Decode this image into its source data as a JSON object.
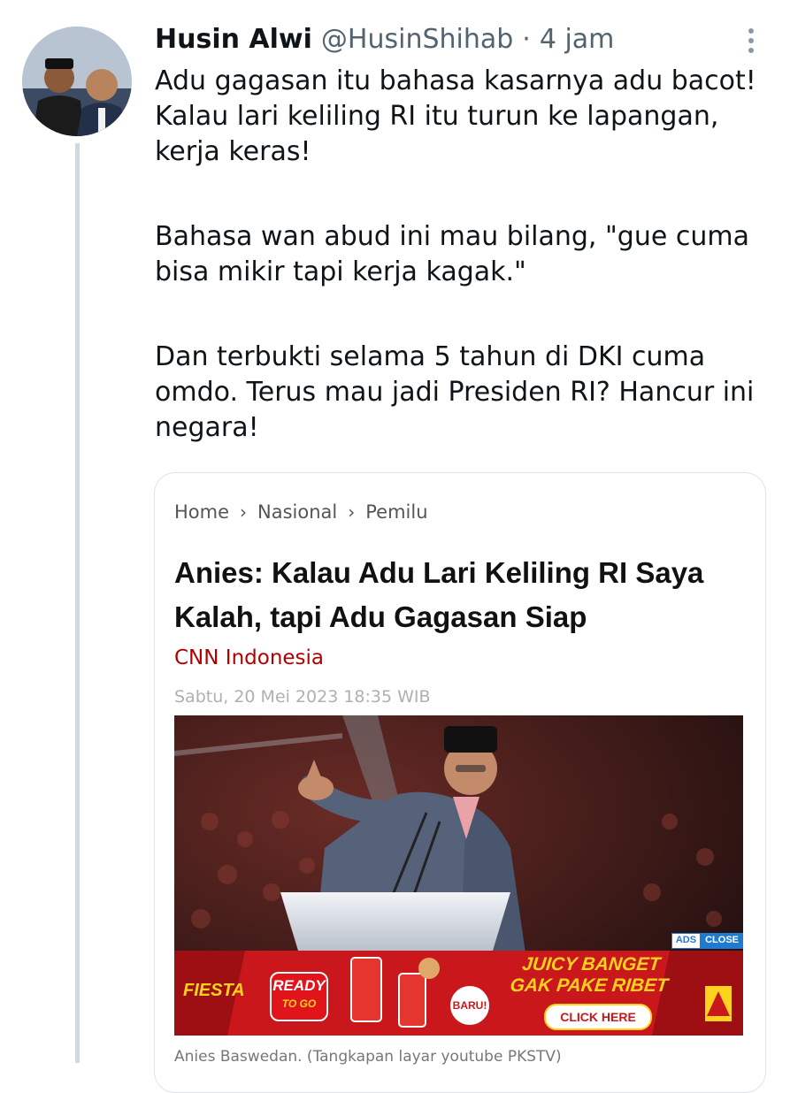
{
  "tweet": {
    "display_name": "Husin Alwi",
    "handle": "@HusinShihab",
    "separator": "·",
    "time": "4 jam",
    "paragraphs": [
      "Adu gagasan itu bahasa kasarnya adu bacot! Kalau lari keliling RI itu turun ke lapangan, kerja keras!",
      "Bahasa wan abud ini mau bilang, \"gue cuma bisa mikir tapi kerja kagak.\"",
      "Dan terbukti selama 5 tahun di DKI cuma omdo. Terus mau jadi Presiden RI? Hancur ini negara!"
    ]
  },
  "article": {
    "breadcrumb": [
      "Home",
      "Nasional",
      "Pemilu"
    ],
    "breadcrumb_separator": "›",
    "title": "Anies: Kalau Adu Lari Keliling RI Saya Kalah, tapi Adu Gagasan Siap",
    "source": "CNN Indonesia",
    "date": "Sabtu, 20 Mei 2023 18:35 WIB",
    "caption": "Anies Baswedan. (Tangkapan layar youtube PKSTV)",
    "ad": {
      "ads_label": "ADS",
      "close_label": "CLOSE",
      "brand": "FIESTA",
      "ready_line1": "READY",
      "ready_line2": "TO GO",
      "baru": "BARU!",
      "tagline_1": "JUICY BANGET",
      "tagline_2": "GAK PAKE RIBET",
      "cta": "CLICK HERE"
    }
  },
  "colors": {
    "text_primary": "#0f1419",
    "text_secondary": "#536471",
    "source_red": "#b20000",
    "ad_red": "#c9171b",
    "ad_yellow": "#ffd21e"
  },
  "icons": {
    "more": "more-vertical-icon"
  }
}
